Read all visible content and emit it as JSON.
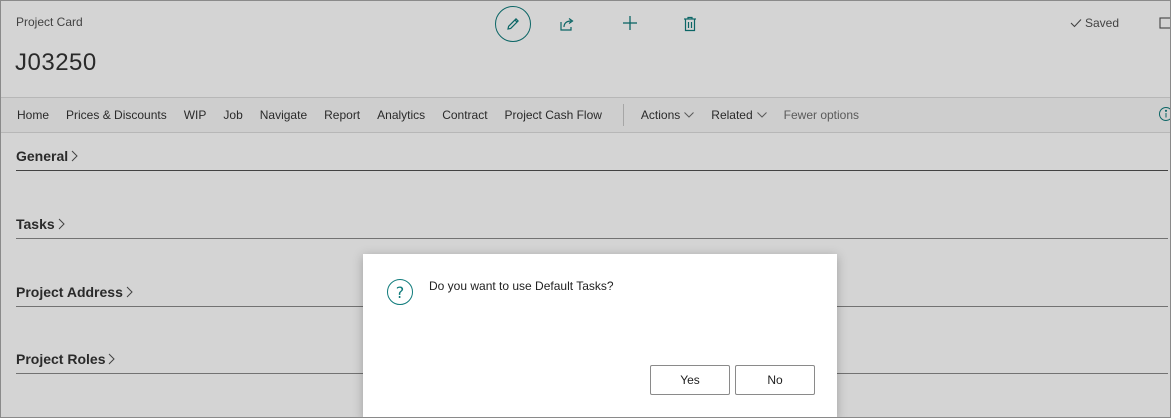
{
  "header": {
    "caption": "Project Card",
    "record_title": "J03250",
    "saved_label": "Saved"
  },
  "action_bar": {
    "items": [
      "Home",
      "Prices & Discounts",
      "WIP",
      "Job",
      "Navigate",
      "Report",
      "Analytics",
      "Contract",
      "Project Cash Flow"
    ],
    "menus": [
      "Actions",
      "Related"
    ],
    "fewer_options": "Fewer options"
  },
  "fasttabs": [
    {
      "label": "General"
    },
    {
      "label": "Tasks"
    },
    {
      "label": "Project Address"
    },
    {
      "label": "Project Roles"
    }
  ],
  "dialog": {
    "icon": "question-icon",
    "message": "Do you want to use Default Tasks?",
    "yes_label": "Yes",
    "no_label": "No"
  },
  "colors": {
    "accent": "#0f7b7b",
    "overlay": "rgba(0,0,0,0.17)"
  }
}
